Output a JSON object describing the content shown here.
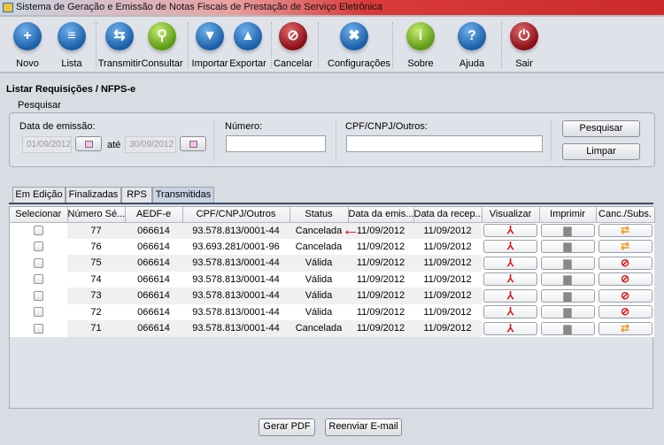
{
  "window": {
    "title": "Sistema de Geração e Emissão de Notas Fiscais de Prestação de Serviço Eletrônica"
  },
  "toolbar": [
    {
      "label": "Novo",
      "icon": "new-document-icon",
      "glyph": "+",
      "color": "blue"
    },
    {
      "label": "Lista",
      "icon": "list-document-icon",
      "glyph": "≡",
      "color": "blue"
    },
    {
      "label": "Transmitir",
      "icon": "transmit-icon",
      "glyph": "⇆",
      "color": "blue"
    },
    {
      "label": "Consultar",
      "icon": "magnifier-icon",
      "glyph": "⚲",
      "color": "green"
    },
    {
      "label": "Importar",
      "icon": "import-arrow-down-icon",
      "glyph": "▼",
      "color": "blue"
    },
    {
      "label": "Exportar",
      "icon": "export-arrow-up-icon",
      "glyph": "▲",
      "color": "blue"
    },
    {
      "label": "Cancelar",
      "icon": "cancel-icon",
      "glyph": "⊘",
      "color": "red"
    },
    {
      "label": "Configurações",
      "icon": "tools-icon",
      "glyph": "✖",
      "color": "blue"
    },
    {
      "label": "Sobre",
      "icon": "info-icon",
      "glyph": "i",
      "color": "green"
    },
    {
      "label": "Ajuda",
      "icon": "help-icon",
      "glyph": "?",
      "color": "blue"
    },
    {
      "label": "Sair",
      "icon": "power-icon",
      "glyph": "⏻",
      "color": "red"
    }
  ],
  "page": {
    "title": "Listar Requisições / NFPS-e"
  },
  "search": {
    "legend": "Pesquisar",
    "date_label": "Data de emissão:",
    "date_from": "01/09/2012",
    "ate": "até",
    "date_to": "30/09/2012",
    "numero_label": "Número:",
    "numero_value": "",
    "cpf_label": "CPF/CNPJ/Outros:",
    "cpf_value": "",
    "search_button": "Pesquisar",
    "clear_button": "Limpar"
  },
  "tabs": [
    {
      "label": "Em Edição"
    },
    {
      "label": "Finalizadas"
    },
    {
      "label": "RPS"
    },
    {
      "label": "Transmitidas",
      "active": true
    }
  ],
  "table": {
    "columns": [
      "Selecionar",
      "Número Sé...",
      "AEDF-e",
      "CPF/CNPJ/Outros",
      "Status",
      "Data da emis...",
      "Data da recep...",
      "Visualizar",
      "Imprimir",
      "Canc./Subs."
    ],
    "rows": [
      {
        "numero": "77",
        "aedf": "066614",
        "cpf": "93.578.813/0001-44",
        "status": "Cancelada",
        "emis": "11/09/2012",
        "recep": "11/09/2012",
        "action": "substitute"
      },
      {
        "numero": "76",
        "aedf": "066614",
        "cpf": "93.693.281/0001-96",
        "status": "Cancelada",
        "emis": "11/09/2012",
        "recep": "11/09/2012",
        "action": "substitute"
      },
      {
        "numero": "75",
        "aedf": "066614",
        "cpf": "93.578.813/0001-44",
        "status": "Válida",
        "emis": "11/09/2012",
        "recep": "11/09/2012",
        "action": "cancel"
      },
      {
        "numero": "74",
        "aedf": "066614",
        "cpf": "93.578.813/0001-44",
        "status": "Válida",
        "emis": "11/09/2012",
        "recep": "11/09/2012",
        "action": "cancel"
      },
      {
        "numero": "73",
        "aedf": "066614",
        "cpf": "93.578.813/0001-44",
        "status": "Válida",
        "emis": "11/09/2012",
        "recep": "11/09/2012",
        "action": "cancel"
      },
      {
        "numero": "72",
        "aedf": "066614",
        "cpf": "93.578.813/0001-44",
        "status": "Válida",
        "emis": "11/09/2012",
        "recep": "11/09/2012",
        "action": "cancel"
      },
      {
        "numero": "71",
        "aedf": "066614",
        "cpf": "93.578.813/0001-44",
        "status": "Cancelada",
        "emis": "11/09/2012",
        "recep": "11/09/2012",
        "action": "substitute"
      }
    ]
  },
  "footer": {
    "gerar_pdf": "Gerar PDF",
    "reenviar": "Reenviar E-mail"
  },
  "annotation": {
    "arrow": "←",
    "color": "#e01010"
  }
}
